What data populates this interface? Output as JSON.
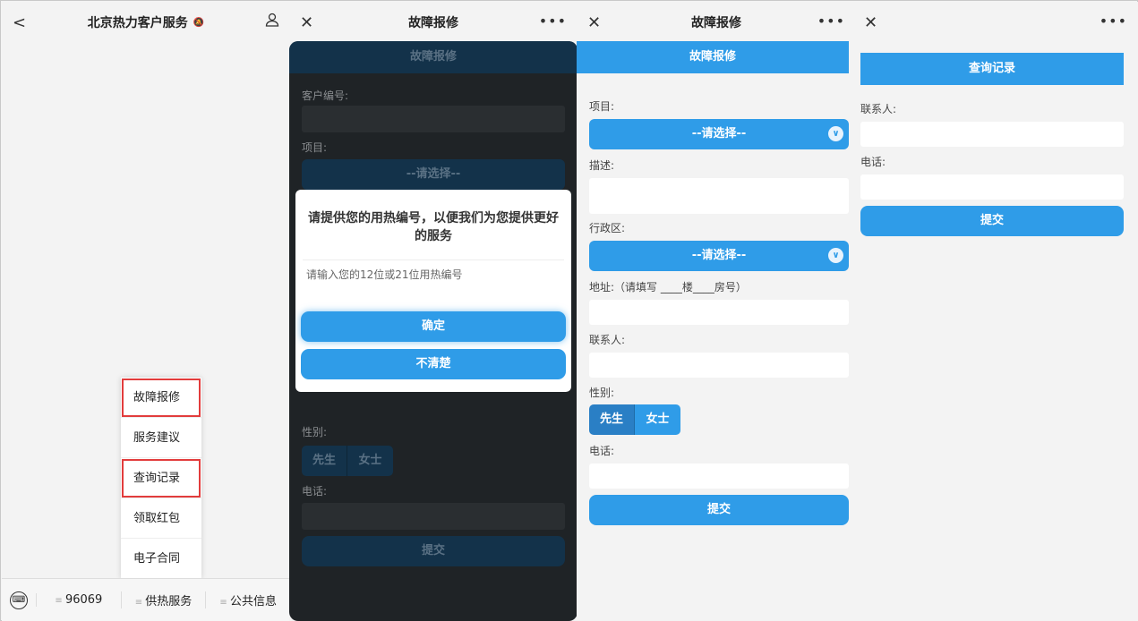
{
  "panel1": {
    "title": "北京热力客户服务",
    "back_icon": "chevron-left-icon",
    "bell_icon": "bell-off-icon",
    "user_icon": "user-icon",
    "menu": [
      "故障报修",
      "服务建议",
      "查询记录",
      "领取红包",
      "电子合同"
    ],
    "bottom": [
      "96069",
      "供热服务",
      "公共信息"
    ]
  },
  "panel2": {
    "title": "故障报修",
    "bar": "故障报修",
    "customer_label": "客户编号:",
    "project_label": "项目:",
    "select_placeholder": "--请选择--",
    "gender_label": "性别:",
    "male": "先生",
    "female": "女士",
    "phone_label": "电话:",
    "submit": "提交",
    "dialog": {
      "message": "请提供您的用热编号，以便我们为您提供更好的服务",
      "placeholder": "请输入您的12位或21位用热编号",
      "confirm": "确定",
      "unsure": "不清楚"
    }
  },
  "panel3": {
    "title": "故障报修",
    "bar": "故障报修",
    "project_label": "项目:",
    "select_placeholder": "--请选择--",
    "desc_label": "描述:",
    "district_label": "行政区:",
    "address_label": "地址:（请填写 ____楼____房号）",
    "contact_label": "联系人:",
    "gender_label": "性别:",
    "male": "先生",
    "female": "女士",
    "phone_label": "电话:",
    "submit": "提交"
  },
  "panel4": {
    "bar": "查询记录",
    "contact_label": "联系人:",
    "phone_label": "电话:",
    "submit": "提交"
  },
  "colors": {
    "accent": "#2f9ce8",
    "highlight": "#e23c3c",
    "dark_overlay": "#1f2326"
  }
}
